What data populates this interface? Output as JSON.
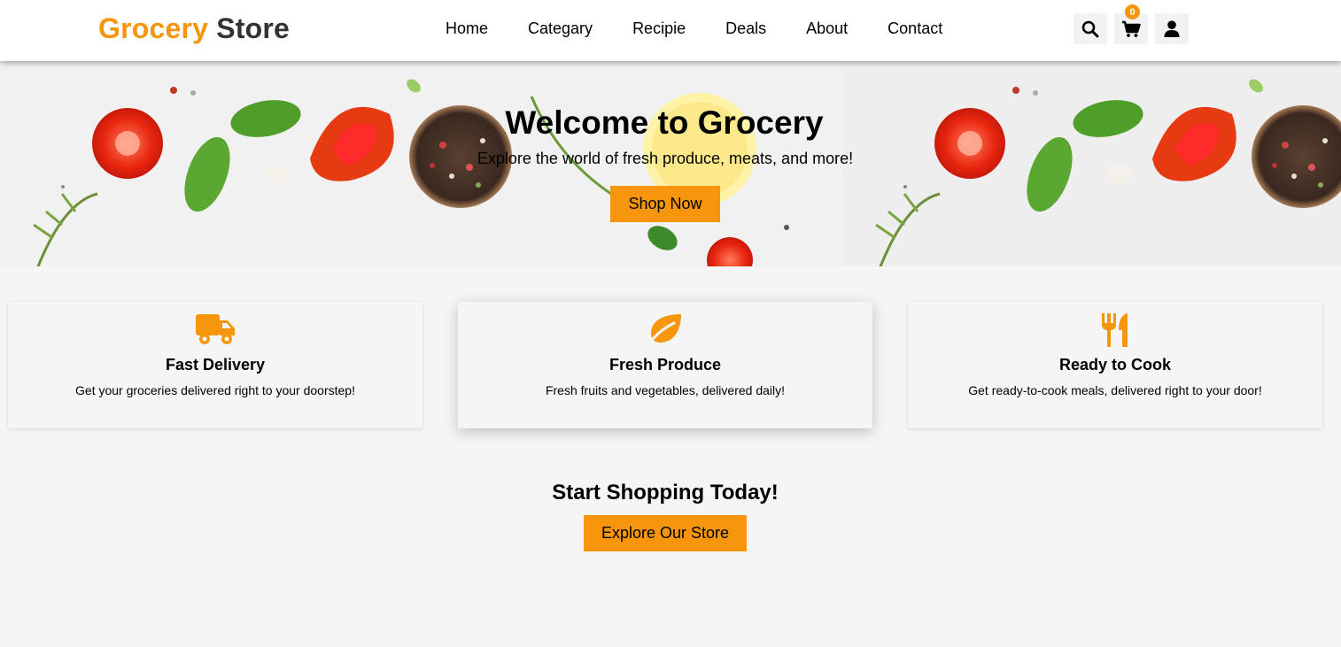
{
  "header": {
    "logo_part1": "Grocery",
    "logo_part2": "Store",
    "nav": [
      "Home",
      "Categary",
      "Recipie",
      "Deals",
      "About",
      "Contact"
    ],
    "cart_count": "0",
    "icons": [
      "search-icon",
      "cart-icon",
      "user-icon"
    ]
  },
  "hero": {
    "title": "Welcome to Grocery",
    "subtitle": "Explore the world of fresh produce, meats, and more!",
    "button": "Shop Now"
  },
  "features": [
    {
      "icon": "truck-icon",
      "title": "Fast Delivery",
      "text": "Get your groceries delivered right to your doorstep!"
    },
    {
      "icon": "leaf-icon",
      "title": "Fresh Produce",
      "text": "Fresh fruits and vegetables, delivered daily!"
    },
    {
      "icon": "utensils-icon",
      "title": "Ready to Cook",
      "text": "Get ready-to-cook meals, delivered right to your door!"
    }
  ],
  "cta": {
    "title": "Start Shopping Today!",
    "button": "Explore Our Store"
  },
  "colors": {
    "accent": "#f7960d",
    "logo_dark": "#333333",
    "background": "#f5f5f5"
  }
}
